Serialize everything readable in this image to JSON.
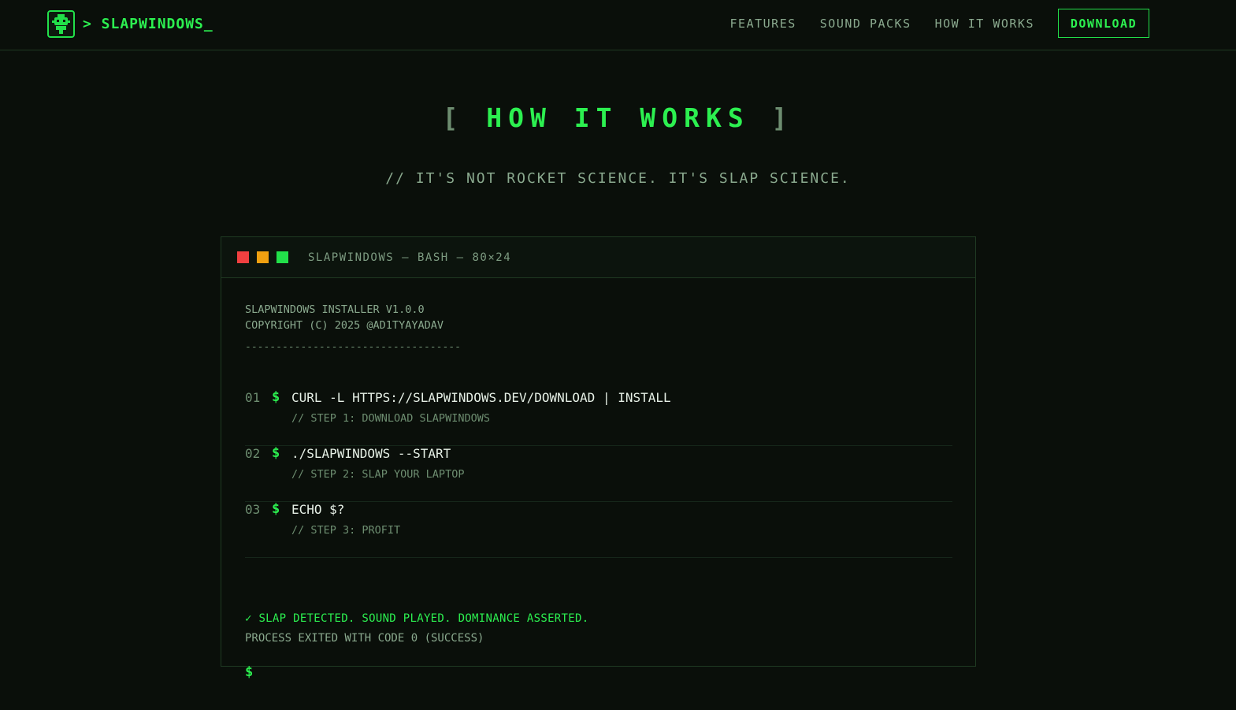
{
  "nav": {
    "brand": "> SLAPWINDOWS_",
    "links": [
      "FEATURES",
      "SOUND PACKS",
      "HOW IT WORKS"
    ],
    "download": "DOWNLOAD"
  },
  "section": {
    "title_open": "[",
    "title": "HOW IT WORKS",
    "title_close": "]",
    "subtitle": "// IT'S NOT ROCKET SCIENCE. IT'S SLAP SCIENCE."
  },
  "terminal": {
    "title": "SLAPWINDOWS — BASH — 80×24",
    "meta_line1": "SLAPWINDOWS INSTALLER V1.0.0",
    "meta_line2": "COPYRIGHT (C) 2025 @AD1TYAYADAV",
    "divider": "-----------------------------------",
    "prompt": "$",
    "steps": [
      {
        "num": "01",
        "cmd": "CURL -L HTTPS://SLAPWINDOWS.DEV/DOWNLOAD | INSTALL",
        "note": "// STEP 1: DOWNLOAD SLAPWINDOWS"
      },
      {
        "num": "02",
        "cmd": "./SLAPWINDOWS --START",
        "note": "// STEP 2: SLAP YOUR LAPTOP"
      },
      {
        "num": "03",
        "cmd": "ECHO $?",
        "note": "// STEP 3: PROFIT"
      }
    ],
    "success": "✓ SLAP DETECTED. SOUND PLAYED. DOMINANCE ASSERTED.",
    "exit": "PROCESS EXITED WITH CODE 0 (SUCCESS)",
    "final_prompt": "$"
  },
  "colors": {
    "accent": "#22e04a",
    "background": "#0a0f0a",
    "dot_red": "#f04040",
    "dot_yellow": "#f0a010",
    "dot_green": "#22e04a"
  },
  "icons": {
    "logo": "robot-face-icon"
  }
}
